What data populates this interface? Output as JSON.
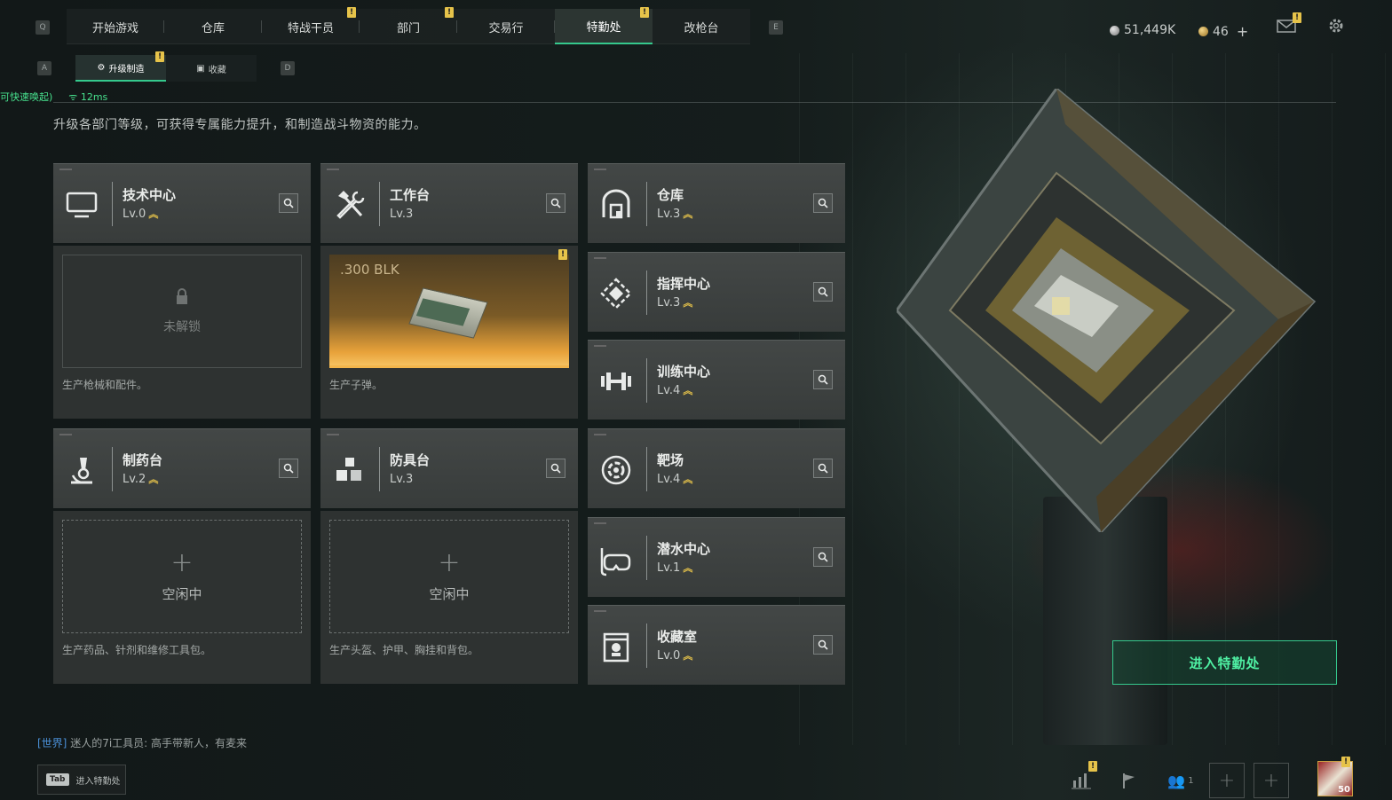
{
  "nav": {
    "left_key": "Q",
    "right_key": "E",
    "tabs": [
      {
        "label": "开始游戏"
      },
      {
        "label": "仓库"
      },
      {
        "label": "特战干员"
      },
      {
        "label": "部门"
      },
      {
        "label": "交易行"
      },
      {
        "label": "特勤处"
      },
      {
        "label": "改枪台"
      }
    ],
    "badge": "!",
    "currency1": "51,449K",
    "currency2": "46"
  },
  "subnav": {
    "left_key": "A",
    "right_key": "D",
    "tabs": [
      {
        "label": "升级制造"
      },
      {
        "label": "收藏"
      }
    ]
  },
  "status": {
    "hint": "可快速唤起)",
    "ping": "12ms"
  },
  "description": "升级各部门等级，可获得专属能力提升，和制造战斗物资的能力。",
  "departments": [
    {
      "name": "技术中心",
      "level": "Lv.0",
      "icon": "monitor-icon"
    },
    {
      "name": "工作台",
      "level": "Lv.3",
      "icon": "tools-icon"
    },
    {
      "name": "仓库",
      "level": "Lv.3",
      "icon": "warehouse-icon"
    },
    {
      "name": "指挥中心",
      "level": "Lv.3",
      "icon": "command-icon"
    },
    {
      "name": "训练中心",
      "level": "Lv.4",
      "icon": "dumbbell-icon"
    },
    {
      "name": "制药台",
      "level": "Lv.2",
      "icon": "microscope-icon"
    },
    {
      "name": "防具台",
      "level": "Lv.3",
      "icon": "armor-icon"
    },
    {
      "name": "靶场",
      "level": "Lv.4",
      "icon": "target-icon"
    },
    {
      "name": "潜水中心",
      "level": "Lv.1",
      "icon": "diving-mask-icon"
    },
    {
      "name": "收藏室",
      "level": "Lv.0",
      "icon": "collection-icon"
    }
  ],
  "panels": {
    "tech": {
      "status": "未解锁",
      "desc": "生产枪械和配件。"
    },
    "workbench": {
      "item": ".300 BLK",
      "desc": "生产子弹。"
    },
    "pharma": {
      "status": "空闲中",
      "desc": "生产药品、针剂和维修工具包。"
    },
    "armor": {
      "status": "空闲中",
      "desc": "生产头盔、护甲、胸挂和背包。"
    }
  },
  "enter_button": "进入特勤处",
  "chat": {
    "channel": "[世界]",
    "sender": "迷人的7i工具员:",
    "message": "高手带新人，有麦来"
  },
  "tab_hint": {
    "key": "Tab",
    "label": "进入特勤处"
  },
  "friends_count": "1",
  "avatar_level": "50",
  "colors": {
    "accent": "#35c98d",
    "badge": "#e6c34a",
    "ammo": "#f2b54b"
  }
}
